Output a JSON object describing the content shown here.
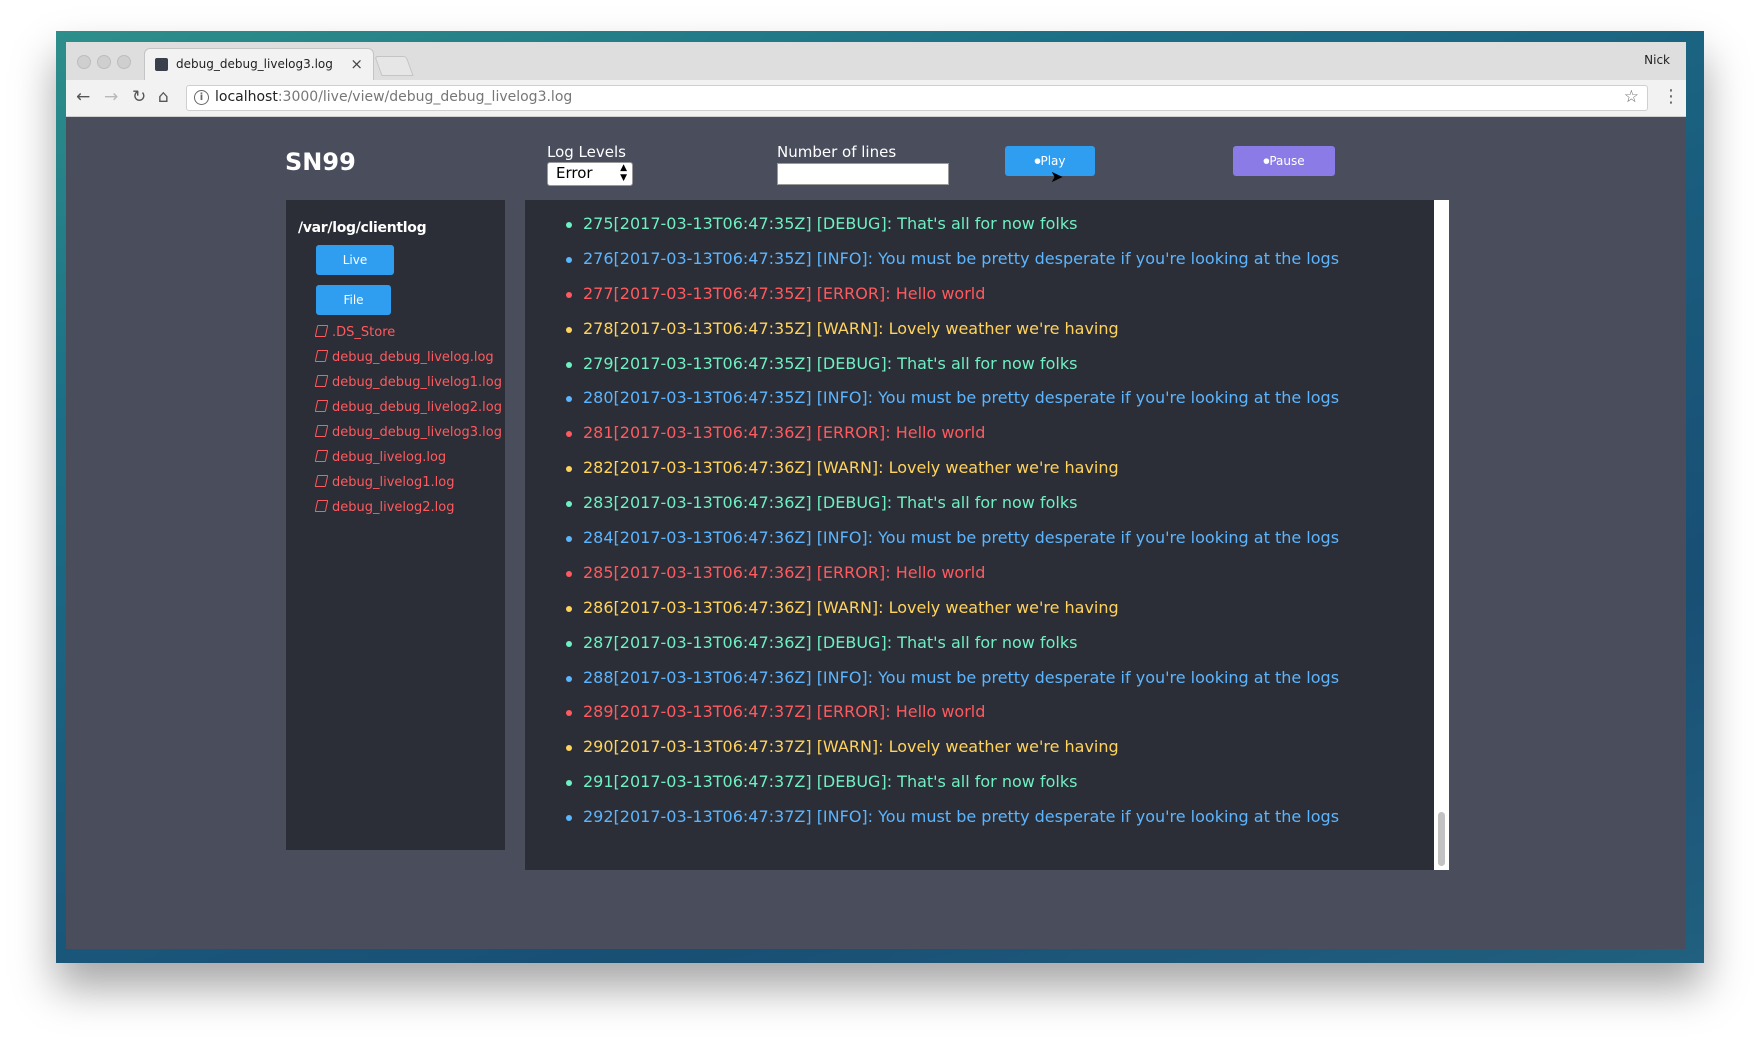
{
  "browser": {
    "tab_title": "debug_debug_livelog3.log",
    "tab_close": "×",
    "profile_name": "Nick",
    "url_host": "localhost",
    "url_path": ":3000/live/view/debug_debug_livelog3.log",
    "icons": {
      "back": "←",
      "forward": "→",
      "reload": "↻",
      "home": "⌂",
      "info": "i",
      "star": "☆",
      "menu": "⋮"
    }
  },
  "app": {
    "brand": "SN99",
    "log_levels_label": "Log Levels",
    "log_level_selected": "Error",
    "select_arrows": "▲▼",
    "lines_label": "Number of lines",
    "lines_value": "",
    "play_label": "⏺Play",
    "pause_label": "⏺Pause"
  },
  "sidebar": {
    "directory": "/var/log/clientlog",
    "live_label": "Live",
    "file_label": "File",
    "files": [
      ".DS_Store",
      "debug_debug_livelog.log",
      "debug_debug_livelog1.log",
      "debug_debug_livelog2.log",
      "debug_debug_livelog3.log",
      "debug_livelog.log",
      "debug_livelog1.log",
      "debug_livelog2.log"
    ]
  },
  "colors": {
    "DEBUG": "#6ff0c3",
    "INFO": "#5cb5ff",
    "ERROR": "#ff5a5f",
    "WARN": "#ffd35c",
    "play": "#2f9ef0",
    "pause": "#8a7be6"
  },
  "logs": [
    {
      "text": "275[2017-03-13T06:47:35Z] [DEBUG]: That's all for now folks",
      "level": "DEBUG"
    },
    {
      "text": "276[2017-03-13T06:47:35Z] [INFO]: You must be pretty desperate if you're looking at the logs",
      "level": "INFO"
    },
    {
      "text": "277[2017-03-13T06:47:35Z] [ERROR]: Hello world",
      "level": "ERROR"
    },
    {
      "text": "278[2017-03-13T06:47:35Z] [WARN]: Lovely weather we're having",
      "level": "WARN"
    },
    {
      "text": "279[2017-03-13T06:47:35Z] [DEBUG]: That's all for now folks",
      "level": "DEBUG"
    },
    {
      "text": "280[2017-03-13T06:47:35Z] [INFO]: You must be pretty desperate if you're looking at the logs",
      "level": "INFO"
    },
    {
      "text": "281[2017-03-13T06:47:36Z] [ERROR]: Hello world",
      "level": "ERROR"
    },
    {
      "text": "282[2017-03-13T06:47:36Z] [WARN]: Lovely weather we're having",
      "level": "WARN"
    },
    {
      "text": "283[2017-03-13T06:47:36Z] [DEBUG]: That's all for now folks",
      "level": "DEBUG"
    },
    {
      "text": "284[2017-03-13T06:47:36Z] [INFO]: You must be pretty desperate if you're looking at the logs",
      "level": "INFO"
    },
    {
      "text": "285[2017-03-13T06:47:36Z] [ERROR]: Hello world",
      "level": "ERROR"
    },
    {
      "text": "286[2017-03-13T06:47:36Z] [WARN]: Lovely weather we're having",
      "level": "WARN"
    },
    {
      "text": "287[2017-03-13T06:47:36Z] [DEBUG]: That's all for now folks",
      "level": "DEBUG"
    },
    {
      "text": "288[2017-03-13T06:47:36Z] [INFO]: You must be pretty desperate if you're looking at the logs",
      "level": "INFO"
    },
    {
      "text": "289[2017-03-13T06:47:37Z] [ERROR]: Hello world",
      "level": "ERROR"
    },
    {
      "text": "290[2017-03-13T06:47:37Z] [WARN]: Lovely weather we're having",
      "level": "WARN"
    },
    {
      "text": "291[2017-03-13T06:47:37Z] [DEBUG]: That's all for now folks",
      "level": "DEBUG"
    },
    {
      "text": "292[2017-03-13T06:47:37Z] [INFO]: You must be pretty desperate if you're looking at the logs",
      "level": "INFO"
    }
  ]
}
